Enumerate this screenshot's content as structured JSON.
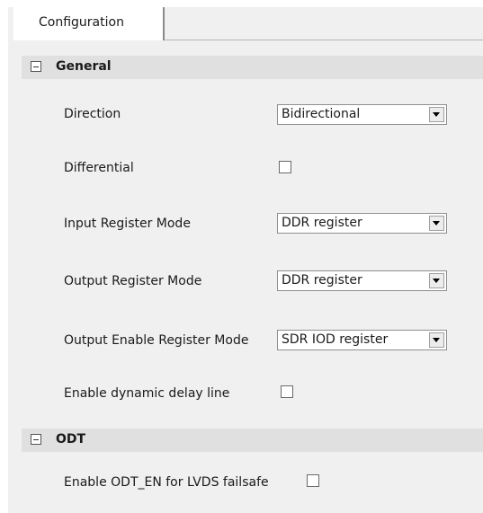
{
  "tabs": [
    {
      "label": "Configuration"
    }
  ],
  "sections": {
    "general": {
      "title": "General"
    },
    "odt": {
      "title": "ODT"
    }
  },
  "fields": {
    "direction": {
      "label": "Direction",
      "value": "Bidirectional"
    },
    "differential": {
      "label": "Differential",
      "checked": false
    },
    "input_register_mode": {
      "label": "Input Register Mode",
      "value": "DDR register"
    },
    "output_register_mode": {
      "label": "Output Register Mode",
      "value": "DDR register"
    },
    "output_enable_register_mode": {
      "label": "Output Enable Register Mode",
      "value": "SDR IOD register"
    },
    "enable_dynamic_delay_line": {
      "label": "Enable dynamic delay line",
      "checked": false
    },
    "enable_odt_en": {
      "label": "Enable ODT_EN for LVDS failsafe",
      "checked": false
    }
  }
}
